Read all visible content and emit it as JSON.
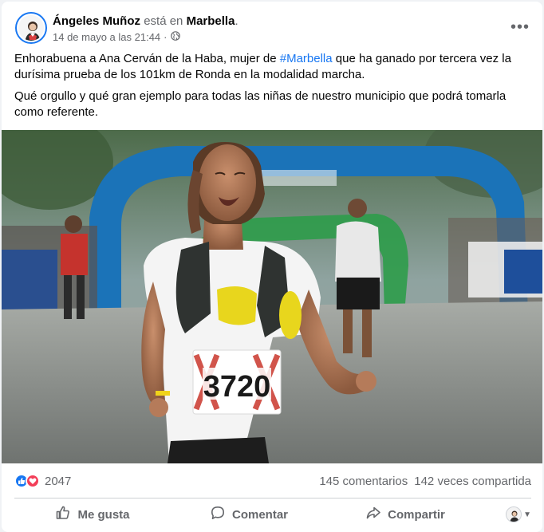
{
  "post": {
    "author": "Ángeles Muñoz",
    "verb": "está en",
    "place": "Marbella",
    "place_suffix": ".",
    "timestamp": "14 de mayo a las 21:44",
    "separator": "·",
    "privacy_icon": "globe-icon",
    "more_icon": "more-options-icon",
    "more_label": "•••",
    "paragraph1_before": "Enhorabuena a Ana Cerván de la Haba, mujer de ",
    "hashtag": "#Marbella",
    "paragraph1_after": " que ha ganado por tercera vez la durísima prueba de los 101km de Ronda en la modalidad marcha.",
    "paragraph2": "Qué orgullo y qué gran ejemplo para todas las niñas de nuestro municipio que podrá tomarla como referente.",
    "photo": {
      "bib_number": "3720"
    }
  },
  "stats": {
    "reactions_count": "2047",
    "reaction_icons": [
      "like-icon",
      "love-icon"
    ],
    "comments": "145 comentarios",
    "shares": "142 veces compartida"
  },
  "actions": {
    "like": "Me gusta",
    "comment": "Comentar",
    "share": "Compartir"
  },
  "colors": {
    "accent": "#1877f2",
    "love": "#f33e58",
    "secondary_text": "#65676b"
  }
}
